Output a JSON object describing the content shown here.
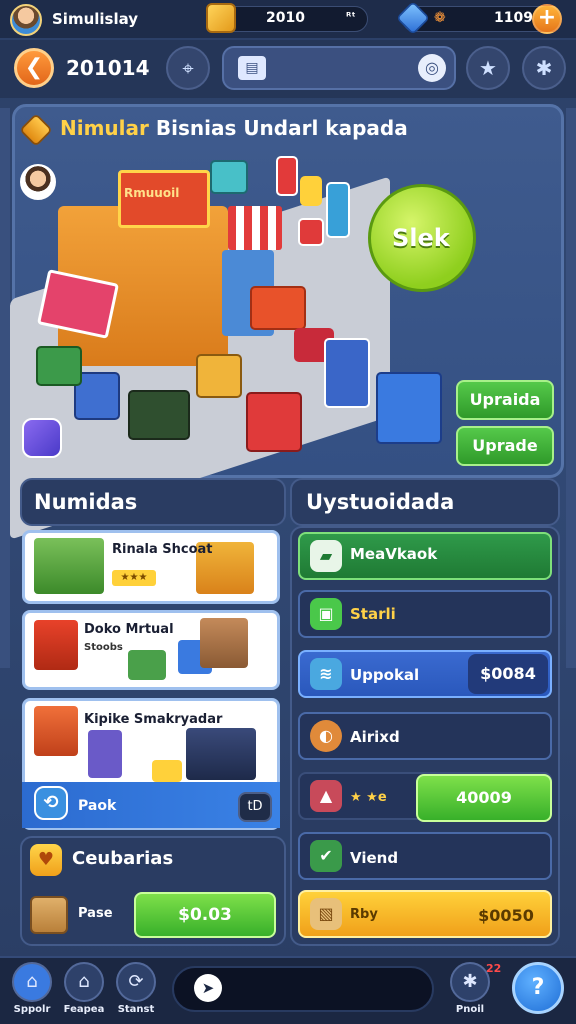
{
  "top_bar": {
    "title": "Simulislay",
    "coins": "2010",
    "coins_suffix": "ᴿᵗ",
    "gems": "1109",
    "gems_prefix": "❁",
    "plus": "+"
  },
  "nav": {
    "back_glyph": "❮",
    "level": "201014",
    "icons": [
      "crosshair-icon",
      "calendar-icon",
      "search-icon",
      "star-icon",
      "gear-icon"
    ]
  },
  "scene": {
    "title_highlight": "Nimular",
    "title_rest": " Bisnias Undarl kapada",
    "shop_sign": "Rmuuoil",
    "bubble_text": "Slek",
    "upgrade_top": "Upraida",
    "upgrade_bottom": "Uprade"
  },
  "left": {
    "heading": "Numidas",
    "cards": [
      {
        "title": "Rinala Shcoat",
        "tag": "★★★"
      },
      {
        "title": "Doko Mrtual",
        "sub": "Stoobs"
      },
      {
        "title": "Kipike Smakryadar",
        "pack_label": "Paok",
        "badge": "tD"
      }
    ],
    "bottom": {
      "title": "Ceubarias",
      "label": "Pase",
      "price": "$0.03"
    }
  },
  "right": {
    "heading": "Uystuoidada",
    "rows": [
      {
        "label": "MeaVkaok"
      },
      {
        "label": "Starli"
      },
      {
        "label": "Uppokal",
        "price": "$0084"
      },
      {
        "label": "Airixd"
      },
      {
        "label": "★ ★e",
        "price": "40009"
      },
      {
        "label": "Viend"
      },
      {
        "label": "Rby",
        "price": "$0050"
      }
    ]
  },
  "bottom_nav": {
    "items": [
      {
        "label": "Sppolr",
        "icon": "home-icon"
      },
      {
        "label": "Feapea",
        "icon": "house-icon"
      },
      {
        "label": "Stanst",
        "icon": "cycle-icon"
      },
      {
        "label": "Pnoil",
        "icon": "gear-icon"
      }
    ],
    "notif": "22",
    "help": "?"
  }
}
